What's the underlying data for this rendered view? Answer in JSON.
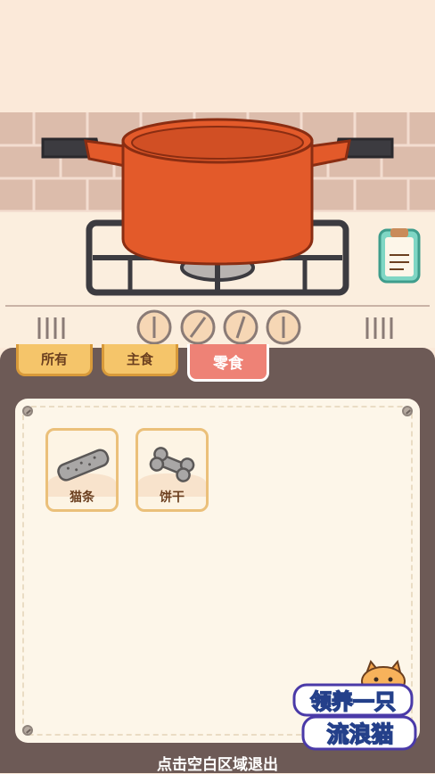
{
  "tabs": [
    {
      "label": "所有"
    },
    {
      "label": "主食"
    },
    {
      "label": "零食",
      "active": true
    }
  ],
  "items": [
    {
      "label": "猫条",
      "icon": "cat-strip-icon"
    },
    {
      "label": "饼干",
      "icon": "bone-biscuit-icon"
    }
  ],
  "footer": {
    "hint": "点击空白区域退出"
  },
  "logo": {
    "line1": "领养一只",
    "line2": "流浪猫"
  },
  "colors": {
    "wall": "#fbe9d9",
    "tile": "#d9b6a6",
    "pot": "#e35a2a",
    "panel": "#6d5a56",
    "active_tab": "#ee8276",
    "tab": "#f5c56a"
  }
}
